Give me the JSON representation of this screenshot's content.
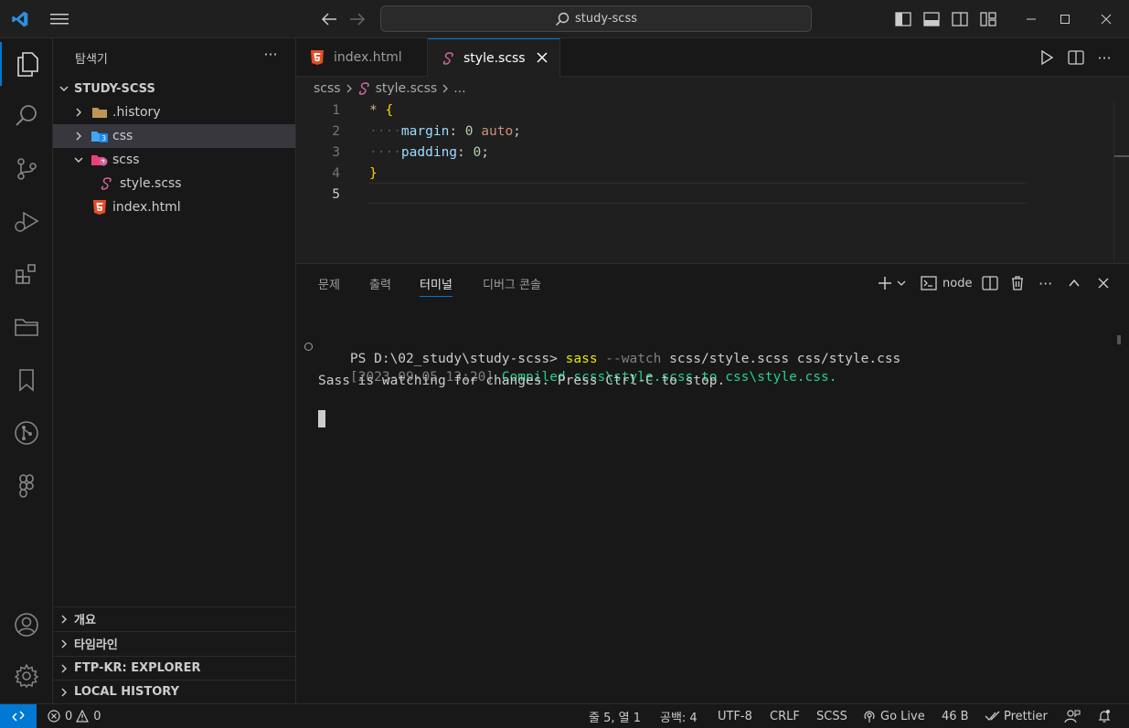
{
  "window": {
    "search_text": "study-scss"
  },
  "sidebar": {
    "title": "탐색기",
    "more": "···",
    "root": "STUDY-SCSS",
    "tree": [
      {
        "label": ".history",
        "type": "folder"
      },
      {
        "label": "css",
        "type": "folder-css"
      },
      {
        "label": "scss",
        "type": "folder-sass"
      },
      {
        "label": "style.scss",
        "type": "sass-file"
      },
      {
        "label": "index.html",
        "type": "html-file"
      }
    ],
    "sections": [
      "개요",
      "타임라인",
      "FTP-KR: EXPLORER",
      "LOCAL HISTORY"
    ]
  },
  "tabs": [
    {
      "label": "index.html",
      "active": false
    },
    {
      "label": "style.scss",
      "active": true
    }
  ],
  "breadcrumb": {
    "folder": "scss",
    "file": "style.scss",
    "more": "..."
  },
  "editor": {
    "line_numbers": [
      "1",
      "2",
      "3",
      "4",
      "5"
    ],
    "lines": {
      "l1_sel": "*",
      "l1_brace": "{",
      "l2_ws": "····",
      "l2_prop": "margin",
      "l2_colon": ":",
      "l2_num": "0",
      "l2_val": "auto",
      "l2_semi": ";",
      "l3_ws": "····",
      "l3_prop": "padding",
      "l3_colon": ":",
      "l3_num": "0",
      "l3_semi": ";",
      "l4_brace": "}"
    }
  },
  "panel": {
    "tabs": [
      "문제",
      "출력",
      "터미널",
      "디버그 콘솔"
    ],
    "active_tab": "터미널",
    "terminal_name": "node",
    "terminal": {
      "prompt": "PS D:\\02_study\\study-scss> ",
      "cmd": "sass",
      "args_flag": " --watch",
      "args_rest": " scss/style.scss css/style.css",
      "timestamp": "[2023-09-05 13:20]",
      "compiled": " Compiled scss\\style.scss to css\\style.css.",
      "watching": "Sass is watching for changes. Press Ctrl-C to stop."
    }
  },
  "statusbar": {
    "errors": "0",
    "warnings": "0",
    "position": "줄 5, 열 1",
    "indent": "공백: 4",
    "encoding": "UTF-8",
    "eol": "CRLF",
    "language": "SCSS",
    "golive": "Go Live",
    "size": "46 B",
    "prettier": "Prettier"
  },
  "colors": {
    "accent": "#0078d4",
    "html_icon": "#e44d26",
    "sass_icon": "#cd6799",
    "css_icon": "#42a5f5"
  }
}
